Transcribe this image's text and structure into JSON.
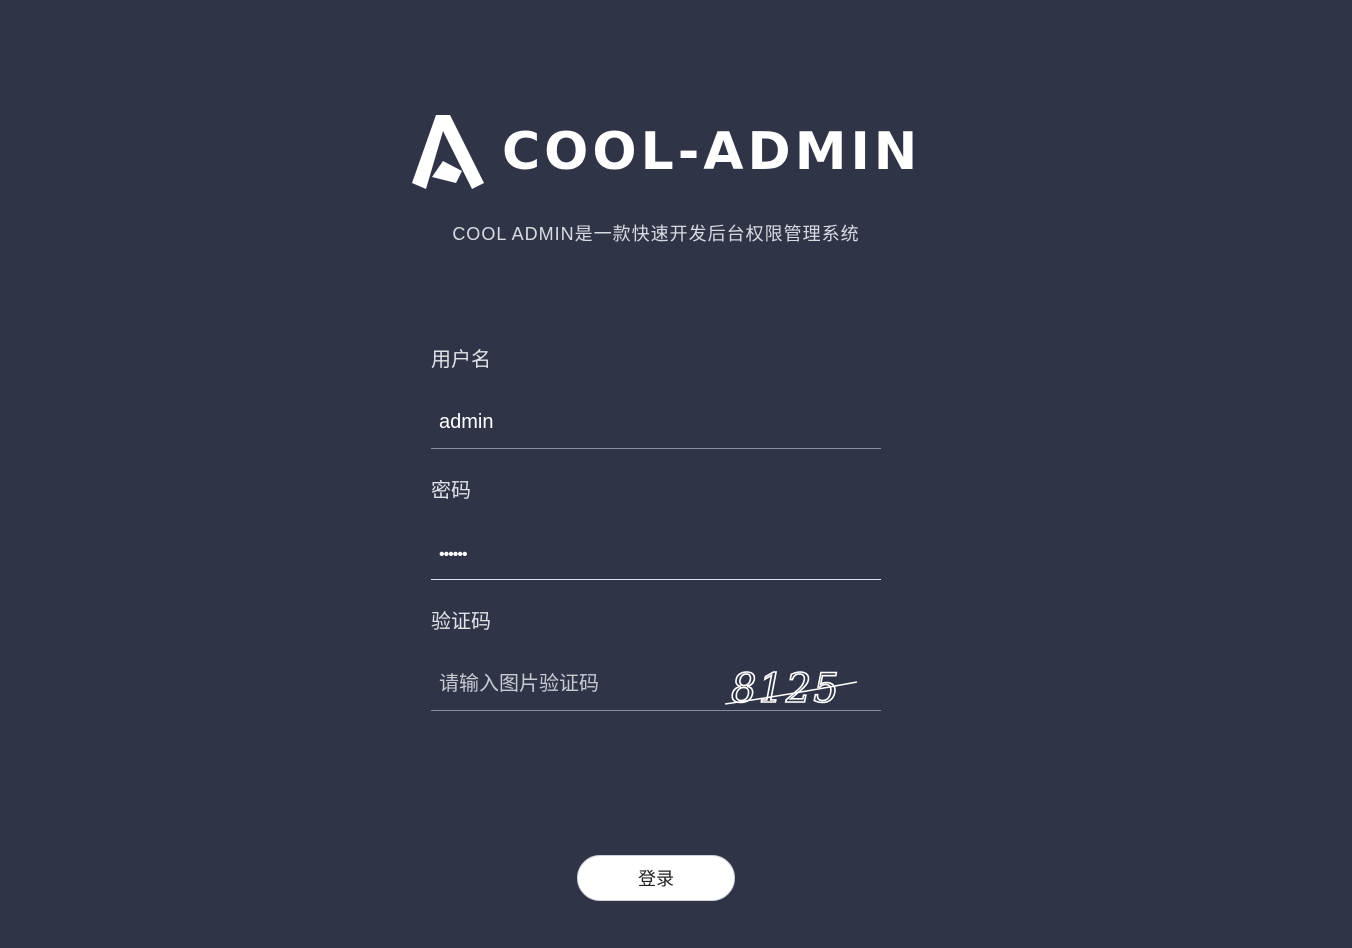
{
  "brand": {
    "logo_icon": "cool-admin-logo-icon",
    "name": "COOL-ADMIN",
    "tagline": "COOL ADMIN是一款快速开发后台权限管理系统"
  },
  "form": {
    "username": {
      "label": "用户名",
      "value": "admin"
    },
    "password": {
      "label": "密码",
      "masked_value": "••••••"
    },
    "captcha": {
      "label": "验证码",
      "placeholder": "请输入图片验证码",
      "image_text": "8125"
    }
  },
  "login_button": {
    "label": "登录"
  },
  "colors": {
    "background": "#2f3447",
    "text": "#ffffff",
    "button_bg": "#ffffff"
  }
}
